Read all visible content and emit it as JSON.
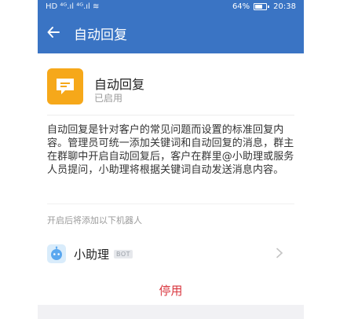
{
  "statusbar": {
    "left_glyphs": "HD ⁴ᴳ.ıl ⁴ᴳ.ıl ≋",
    "battery": "64%",
    "time": "20:38"
  },
  "header": {
    "title": "自动回复"
  },
  "app": {
    "name": "自动回复",
    "status": "已启用",
    "description": "自动回复是针对客户的常见问题而设置的标准回复内容。管理员可统一添加关键词和自动回复的消息，群主在群聊中开启自动回复后，客户在群里@小助理或服务人员提问，小助理将根据关键词自动发送消息内容。"
  },
  "robots": {
    "section_label": "开启后将添加以下机器人",
    "items": [
      {
        "name": "小助理",
        "badge": "BOT"
      }
    ]
  },
  "actions": {
    "disable_label": "停用"
  },
  "colors": {
    "header_blue": "#3a74c4",
    "app_icon_orange": "#f6a81a",
    "danger_red": "#d9363e"
  }
}
